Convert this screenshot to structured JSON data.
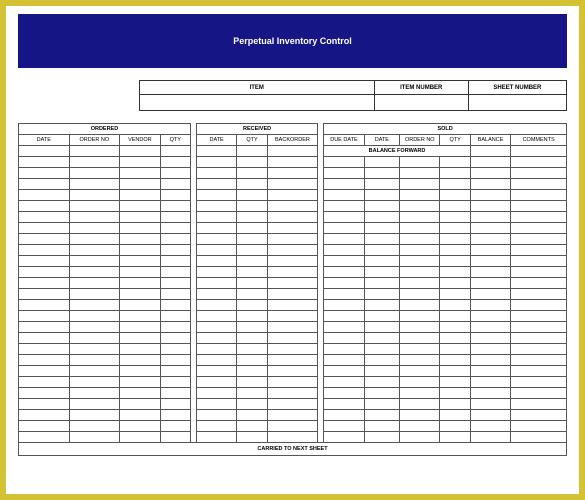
{
  "title": "Perpetual Inventory Control",
  "meta": {
    "item_label": "ITEM",
    "item_number_label": "ITEM NUMBER",
    "sheet_number_label": "SHEET NUMBER",
    "item_value": "",
    "item_number_value": "",
    "sheet_number_value": ""
  },
  "groups": {
    "ordered": "ORDERED",
    "received": "RECEIVED",
    "sold": "SOLD"
  },
  "columns": {
    "ordered": [
      "DATE",
      "ORDER NO",
      "VENDOR",
      "QTY"
    ],
    "received": [
      "DATE",
      "QTY",
      "BACKORDER"
    ],
    "sold": [
      "DUE DATE",
      "DATE",
      "ORDER NO",
      "QTY",
      "BALANCE",
      "COMMENTS"
    ]
  },
  "balance_forward_label": "BALANCE FORWARD",
  "carried_label": "CARRIED TO NEXT SHEET",
  "row_count": 26
}
